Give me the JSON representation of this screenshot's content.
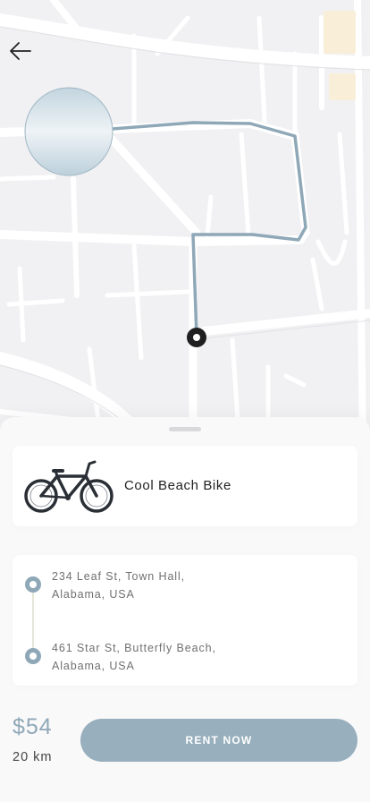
{
  "nav": {
    "back_icon": "arrow-left-icon"
  },
  "bike": {
    "name": "Cool Beach Bike",
    "image_icon": "bicycle-icon"
  },
  "route": {
    "pickup_line1": "234 Leaf St, Town Hall,",
    "pickup_line2": "Alabama, USA",
    "dropoff_line1": "461 Star St, Butterfly Beach,",
    "dropoff_line2": "Alabama, USA"
  },
  "trip": {
    "price": "$54",
    "distance": "20 km"
  },
  "actions": {
    "rent_label": "RENT NOW"
  },
  "colors": {
    "accent": "#98afbd",
    "route": "#8fa8b7",
    "map_bg": "#f1f1f3"
  }
}
